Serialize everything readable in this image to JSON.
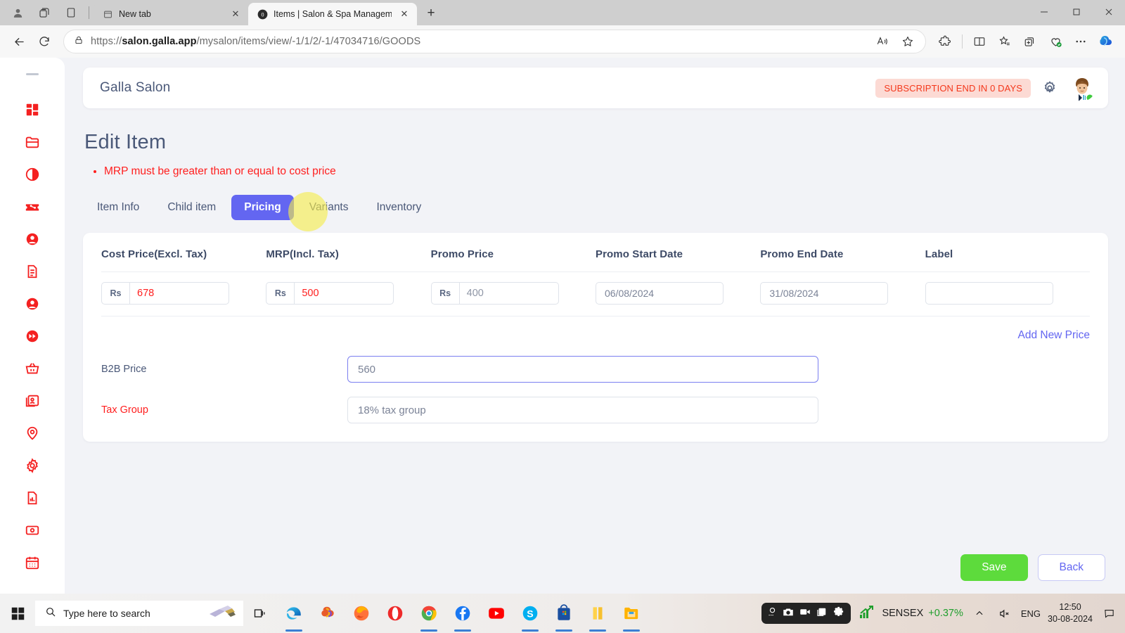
{
  "browser": {
    "tabs": [
      {
        "title": "New tab",
        "favicon": "newtab-icon",
        "active": false
      },
      {
        "title": "Items | Salon & Spa Management",
        "favicon": "galla-icon",
        "active": true
      }
    ],
    "newtab_label": "+",
    "close_glyph": "✕",
    "url_prefix": "https://",
    "url_domain": "salon.galla.app",
    "url_path": "/mysalon/items/view/-1/1/2/-1/47034716/GOODS",
    "window_controls": {
      "minimize": "—",
      "maximize": "❐",
      "close": "✕"
    }
  },
  "sidebar": {
    "items": [
      {
        "icon": "dashboard-grid-icon"
      },
      {
        "icon": "folder-icon"
      },
      {
        "icon": "contrast-circle-icon"
      },
      {
        "icon": "discount-ticket-icon"
      },
      {
        "icon": "user-circle-icon"
      },
      {
        "icon": "document-lines-icon"
      },
      {
        "icon": "user-circle-icon"
      },
      {
        "icon": "fast-forward-icon"
      },
      {
        "icon": "basket-icon"
      },
      {
        "icon": "id-card-icon"
      },
      {
        "icon": "location-pin-icon"
      },
      {
        "icon": "gear-icon"
      },
      {
        "icon": "report-chart-icon"
      },
      {
        "icon": "cash-note-icon"
      },
      {
        "icon": "calendar-icon"
      }
    ]
  },
  "appbar": {
    "title": "Galla Salon",
    "subscription_badge": "SUBSCRIPTION END IN 0 DAYS",
    "badge_bg": "#fcdad4",
    "badge_color": "#f4381c",
    "settings_icon": "gear-icon",
    "avatar": "user-avatar"
  },
  "page": {
    "title": "Edit Item",
    "errors": [
      "MRP must be greater than or equal to cost price"
    ],
    "error_color": "#ff1e1e"
  },
  "tabs": {
    "items": [
      {
        "label": "Item Info",
        "active": false
      },
      {
        "label": "Child item",
        "active": false
      },
      {
        "label": "Pricing",
        "active": true
      },
      {
        "label": "Variants",
        "active": false
      },
      {
        "label": "Inventory",
        "active": false
      }
    ],
    "active_bg": "#6366f1"
  },
  "pricing_table": {
    "headers": [
      "Cost Price(Excl. Tax)",
      "MRP(Incl. Tax)",
      "Promo Price",
      "Promo Start Date",
      "Promo End Date",
      "Label"
    ],
    "rows": [
      {
        "cost_price": {
          "prefix": "Rs",
          "value": "678",
          "error": true
        },
        "mrp": {
          "prefix": "Rs",
          "value": "500",
          "error": true
        },
        "promo_price": {
          "prefix": "Rs",
          "value": "400",
          "error": false
        },
        "promo_start_date": "06/08/2024",
        "promo_end_date": "31/08/2024",
        "label": ""
      }
    ],
    "add_new_price": "Add New Price"
  },
  "fields": {
    "b2b_price": {
      "label": "B2B Price",
      "value": "560",
      "required": false,
      "focused": true
    },
    "tax_group": {
      "label": "Tax Group",
      "value": "18% tax group",
      "required": true,
      "focused": false
    }
  },
  "actions": {
    "save": "Save",
    "back": "Back",
    "save_color": "#5ddb3c",
    "back_color": "#6366f1"
  },
  "taskbar": {
    "search_placeholder": "Type here to search",
    "apps": [
      "edge-icon",
      "copilot-icon",
      "firefox-icon",
      "opera-icon",
      "chrome-icon",
      "facebook-icon",
      "youtube-icon",
      "skype-icon",
      "store-icon",
      "app-yellow-icon",
      "file-explorer-icon"
    ],
    "recorder": {
      "icons": [
        "camera-icon",
        "video-icon",
        "window-icon",
        "gear-icon"
      ]
    },
    "sensex_label": "SENSEX",
    "sensex_change": "+0.37%",
    "sensex_color": "#1f9e2c",
    "language": "ENG",
    "time": "12:50",
    "date": "30-08-2024"
  }
}
